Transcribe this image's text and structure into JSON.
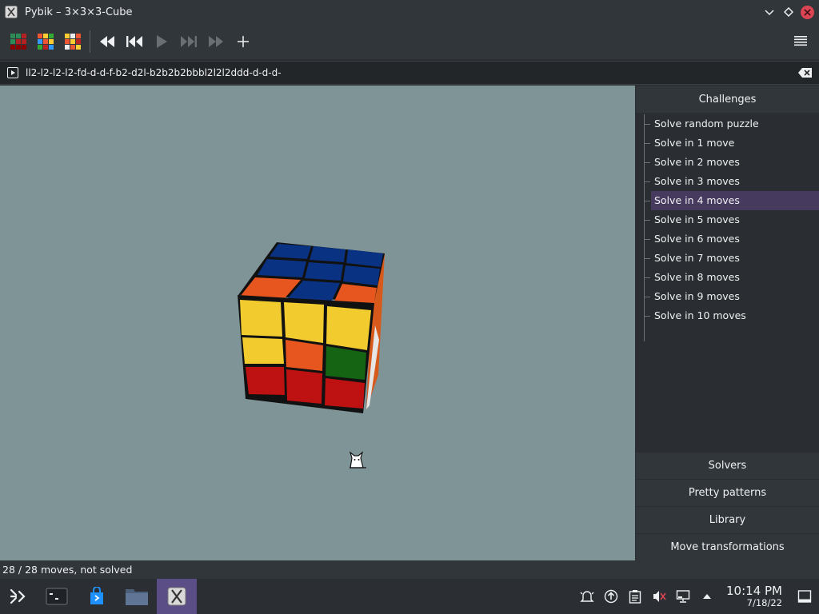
{
  "window": {
    "title": "Pybik – 3×3×3-Cube",
    "app_icon": "pybik-icon",
    "buttons": [
      "minimize-icon",
      "maximize-icon",
      "close-icon"
    ]
  },
  "toolbar": {
    "buttons": [
      {
        "name": "new-solved-puzzle",
        "icon": "cube-solved-icon"
      },
      {
        "name": "new-random-puzzle",
        "icon": "cube-random-icon"
      },
      {
        "name": "new-random-puzzle-2",
        "icon": "cube-mixed-icon"
      },
      {
        "name": "rewind",
        "icon": "rewind-icon"
      },
      {
        "name": "previous",
        "icon": "skip-back-icon"
      },
      {
        "name": "play",
        "icon": "play-icon"
      },
      {
        "name": "next",
        "icon": "skip-forward-icon"
      },
      {
        "name": "forward",
        "icon": "fast-forward-icon"
      },
      {
        "name": "add-mark",
        "icon": "plus-icon"
      }
    ],
    "menu_icon": "hamburger-menu-icon"
  },
  "move_editor": {
    "value": "ll2-l2-l2-l2-fd-d-d-f-b2-d2l-b2b2b2bbbl2l2l2ddd-d-d-d-",
    "play_icon": "play-icon",
    "clear_icon": "clear-text-icon"
  },
  "cube": {
    "colors": {
      "yellow": "#f2cc2e",
      "orange": "#e8561f",
      "blue": "#0a3282",
      "red": "#be1111",
      "green": "#146414",
      "white": "#f0f0f0",
      "edge": "#111111"
    },
    "front": [
      [
        "yellow",
        "yellow",
        "yellow"
      ],
      [
        "yellow",
        "orange",
        "green"
      ],
      [
        "red",
        "red",
        "red"
      ]
    ],
    "top": [
      [
        "blue",
        "blue",
        "blue"
      ],
      [
        "blue",
        "blue",
        "blue"
      ],
      [
        "orange",
        "blue",
        "orange"
      ]
    ]
  },
  "sidebar": {
    "challenges_header": "Challenges",
    "challenges": [
      "Solve random puzzle",
      "Solve in 1 move",
      "Solve in 2 moves",
      "Solve in 3 moves",
      "Solve in 4 moves",
      "Solve in 5 moves",
      "Solve in 6 moves",
      "Solve in 7 moves",
      "Solve in 8 moves",
      "Solve in 9 moves",
      "Solve in 10 moves"
    ],
    "selected_index": 4,
    "sections": [
      "Solvers",
      "Pretty patterns",
      "Library",
      "Move transformations"
    ]
  },
  "status": {
    "text": "28 / 28 moves, not solved"
  },
  "taskbar": {
    "launchers": [
      "application-launcher-icon",
      "virtual-desktops-icon",
      "discover-store-icon",
      "file-manager-icon",
      "pybik-task-icon"
    ],
    "active_index": 4,
    "tray": [
      "notifications-icon",
      "updates-icon",
      "clipboard-icon",
      "volume-muted-icon",
      "network-icon",
      "tray-expand-icon"
    ],
    "time": "10:14 PM",
    "date": "7/18/22",
    "show_desktop_icon": "show-desktop-icon"
  },
  "colors": {
    "accent": "#5b4e86",
    "selection": "#463b5f",
    "viewport_bg": "#7f9496",
    "close_button": "#da4453"
  }
}
